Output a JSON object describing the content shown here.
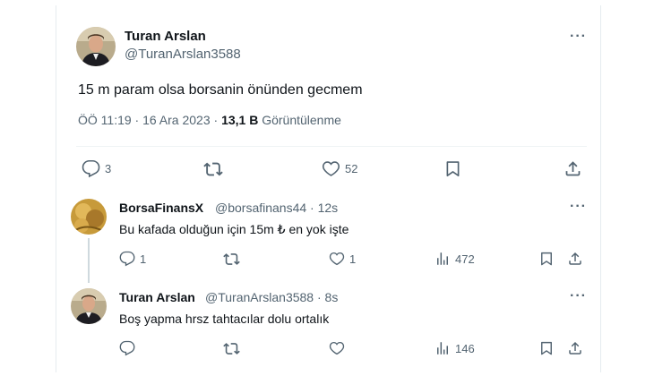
{
  "main_tweet": {
    "author_name": "Turan Arslan",
    "author_handle": "@TuranArslan3588",
    "text": "15 m param olsa borsanin önünden gecmem",
    "time": "ÖÖ 11:19 · 16 Ara 2023 ·",
    "views_count": "13,1 B",
    "views_label": "Görüntülenme",
    "more": "···",
    "actions": {
      "replies": "3",
      "retweets": "",
      "likes": "52"
    }
  },
  "replies": [
    {
      "author_name": "BorsaFinansX",
      "author_handle": "@borsafinans44 · 12s",
      "text": "Bu kafada olduğun için 15m ₺ en yok işte",
      "more": "···",
      "actions": {
        "replies": "1",
        "retweets": "",
        "likes": "1",
        "views": "472"
      }
    },
    {
      "author_name": "Turan Arslan",
      "author_handle": "@TuranArslan3588 · 8s",
      "text": "Boş yapma hrsz tahtacılar dolu ortalık",
      "more": "···",
      "actions": {
        "replies": "",
        "retweets": "",
        "likes": "",
        "views": "146"
      }
    }
  ],
  "colors": {
    "text": "#0f1419",
    "muted": "#536471",
    "border": "#eff3f4"
  },
  "icons": [
    "reply-icon",
    "retweet-icon",
    "like-icon",
    "views-icon",
    "bookmark-icon",
    "share-icon",
    "more-icon"
  ]
}
